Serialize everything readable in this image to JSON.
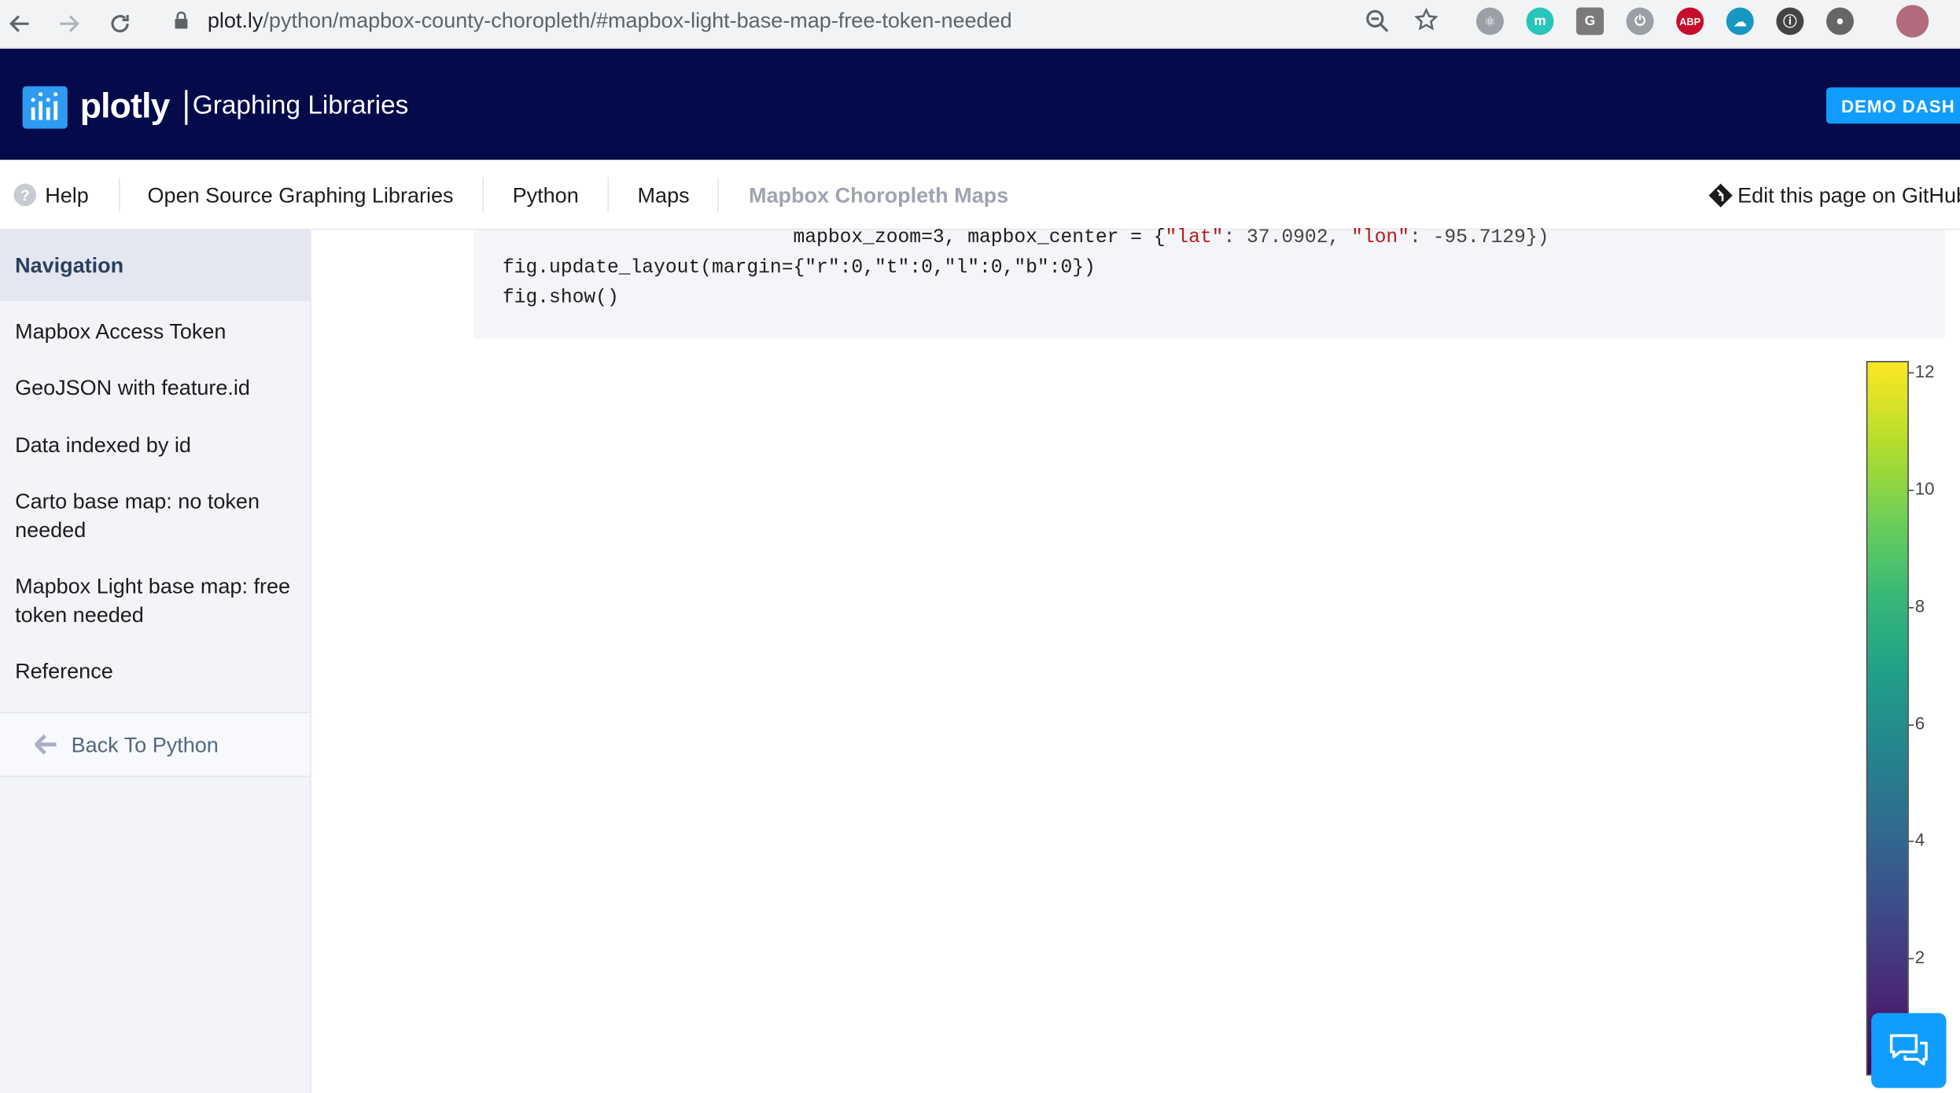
{
  "browser": {
    "url_host": "plot.ly",
    "url_path": "/python/mapbox-county-choropleth/#mapbox-light-base-map-free-token-needed",
    "extensions": [
      {
        "name": "react-devtools-icon",
        "color": "#9aa0a6",
        "glyph": "⚛"
      },
      {
        "name": "m-extension-icon",
        "color": "#26c6b9",
        "glyph": "m"
      },
      {
        "name": "grammarly-icon",
        "color": "#7a7a7a",
        "glyph": "G"
      },
      {
        "name": "power-icon",
        "color": "#9aa0a6",
        "glyph": "⏻"
      },
      {
        "name": "adblock-plus-icon",
        "color": "#c70d2c",
        "glyph": "ABP"
      },
      {
        "name": "salesforce-icon",
        "color": "#1798c1",
        "glyph": "☁"
      },
      {
        "name": "onepassword-icon",
        "color": "#444",
        "glyph": "ⓘ"
      },
      {
        "name": "circle-extension-icon",
        "color": "#666",
        "glyph": "●"
      }
    ]
  },
  "header": {
    "logo": "plotly",
    "subtitle": "Graphing Libraries",
    "demo_button": "DEMO DASH"
  },
  "breadcrumb": {
    "help": "Help",
    "items": [
      "Open Source Graphing Libraries",
      "Python",
      "Maps"
    ],
    "current": "Mapbox Choropleth Maps",
    "edit": "Edit this page on GitHub"
  },
  "sidebar": {
    "heading": "Navigation",
    "items": [
      "Mapbox Access Token",
      "GeoJSON with feature.id",
      "Data indexed by id",
      "Carto base map: no token needed",
      "Mapbox Light base map: free token needed",
      "Reference"
    ],
    "back": "Back To Python"
  },
  "code": {
    "line1_prefix": "                         mapbox_zoom=3, mapbox_center = {",
    "lat_key": "\"lat\"",
    "lat_val": ": 37.0902, ",
    "lon_key": "\"lon\"",
    "lon_val": ": -95.7129})",
    "line2": "fig.update_layout(margin={\"r\":0,\"t\":0,\"l\":0,\"b\":0})",
    "line3": "fig.show()"
  },
  "colorbar": {
    "ticks": [
      "12",
      "10",
      "8",
      "6",
      "4",
      "2"
    ],
    "colors": [
      "#440154",
      "#fde725"
    ]
  }
}
